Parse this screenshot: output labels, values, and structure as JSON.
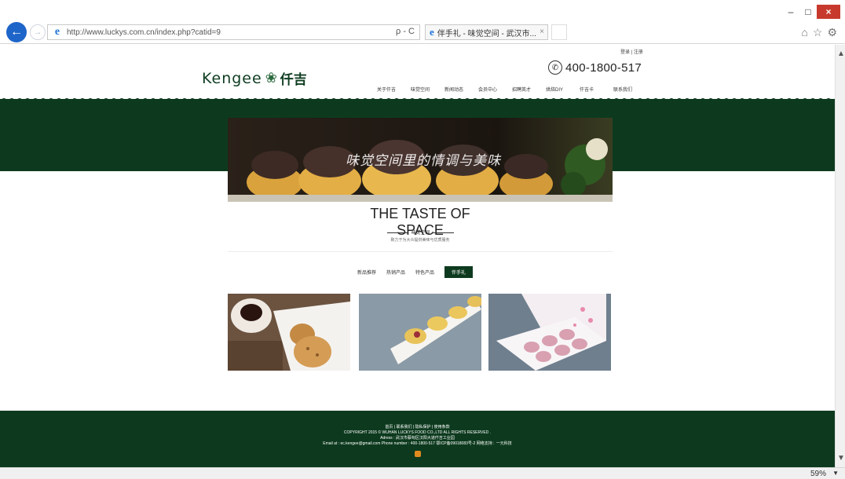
{
  "browser": {
    "url": "http://www.luckys.com.cn/index.php?catid=9",
    "address_tools": "ρ - C",
    "tab_title": "伴手礼 - 味觉空间 - 武汉市...",
    "tab_close": "×",
    "win_min": "–",
    "win_max": "□",
    "win_close": "×",
    "icons": [
      "home-icon",
      "star-icon",
      "gear-icon"
    ],
    "zoom": "59%"
  },
  "header": {
    "logo_en": "Kengee",
    "logo_cn": "仟吉",
    "login": "登录 | 注册",
    "phone": "400-1800-517",
    "nav": [
      "关于仟吉",
      "味觉空间",
      "新闻动态",
      "会员中心",
      "招聘英才",
      "烘焙DIY",
      "仟吉卡",
      "联系我们"
    ]
  },
  "banner": {
    "text": "味觉空间里的情调与美味"
  },
  "section": {
    "title": "THE TASTE OF SPACE",
    "subtitle": "味觉空间",
    "description": "致力于为大众提供美味与优质服务"
  },
  "categories": {
    "items": [
      "新品推荐",
      "热销产品",
      "特色产品"
    ],
    "active": "伴手礼"
  },
  "footer": {
    "links": "首页 | 联系我们 | 隐私保护 | 使用条款",
    "copyright": "COPYRIGHT 2015 © WUHAN LUCKYS FOOD CO.,LTD ALL RIGHTS RESERVED .",
    "address": "Adress : 武汉市蔡甸区汉阳大道仟吉工业园",
    "contact": "Email at : ec.kengee@gmail.com   Phone number : 400-1800-517  鄂ICP备09018083号-2  网络支持：一元科技"
  }
}
